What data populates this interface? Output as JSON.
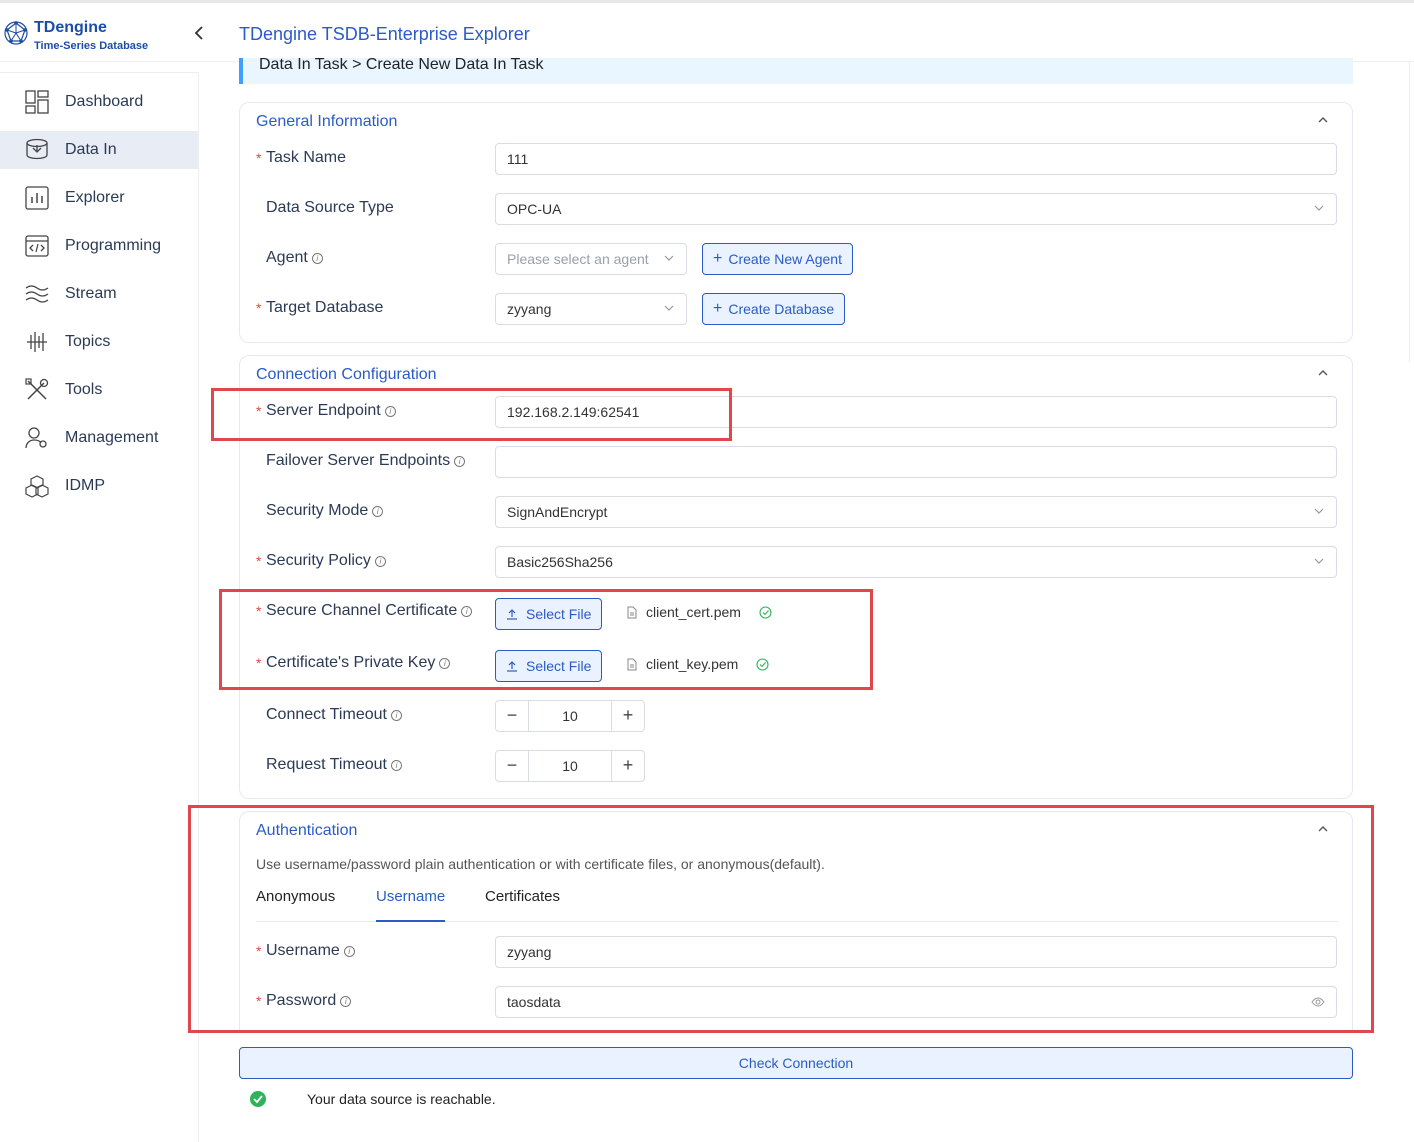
{
  "header": {
    "logo_name": "TDengine",
    "logo_sub": "Time-Series Database",
    "app_title": "TDengine TSDB-Enterprise Explorer"
  },
  "sidebar": {
    "items": [
      {
        "label": "Dashboard",
        "icon": "dashboard-icon"
      },
      {
        "label": "Data In",
        "icon": "data-in-icon",
        "active": true
      },
      {
        "label": "Explorer",
        "icon": "explorer-icon"
      },
      {
        "label": "Programming",
        "icon": "programming-icon"
      },
      {
        "label": "Stream",
        "icon": "stream-icon"
      },
      {
        "label": "Topics",
        "icon": "topics-icon"
      },
      {
        "label": "Tools",
        "icon": "tools-icon"
      },
      {
        "label": "Management",
        "icon": "management-icon"
      },
      {
        "label": "IDMP",
        "icon": "idmp-icon"
      }
    ]
  },
  "breadcrumb": "Data In Task > Create New Data In Task",
  "general": {
    "title": "General Information",
    "task_name_label": "Task Name",
    "task_name_value": "111",
    "source_type_label": "Data Source Type",
    "source_type_value": "OPC-UA",
    "agent_label": "Agent",
    "agent_placeholder": "Please select an agent",
    "create_agent_label": "Create New Agent",
    "target_db_label": "Target Database",
    "target_db_value": "zyyang",
    "create_db_label": "Create Database"
  },
  "connection": {
    "title": "Connection Configuration",
    "server_endpoint_label": "Server Endpoint",
    "server_endpoint_value": "192.168.2.149:62541",
    "failover_label": "Failover Server Endpoints",
    "failover_value": "",
    "security_mode_label": "Security Mode",
    "security_mode_value": "SignAndEncrypt",
    "security_policy_label": "Security Policy",
    "security_policy_value": "Basic256Sha256",
    "channel_cert_label": "Secure Channel Certificate",
    "channel_cert_button": "Select File",
    "channel_cert_file": "client_cert.pem",
    "private_key_label": "Certificate's Private Key",
    "private_key_button": "Select File",
    "private_key_file": "client_key.pem",
    "connect_timeout_label": "Connect Timeout",
    "connect_timeout_value": "10",
    "request_timeout_label": "Request Timeout",
    "request_timeout_value": "10"
  },
  "auth": {
    "title": "Authentication",
    "description": "Use username/password plain authentication or with certificate files, or anonymous(default).",
    "tabs": [
      "Anonymous",
      "Username",
      "Certificates"
    ],
    "active_tab": "Username",
    "username_label": "Username",
    "username_value": "zyyang",
    "password_label": "Password",
    "password_value": "taosdata"
  },
  "check_button": "Check Connection",
  "status_text": "Your data source is reachable.",
  "colors": {
    "accent": "#2a5cc5",
    "required": "#e2463f",
    "success": "#2fb35a",
    "highlight_box": "#e0474c"
  }
}
